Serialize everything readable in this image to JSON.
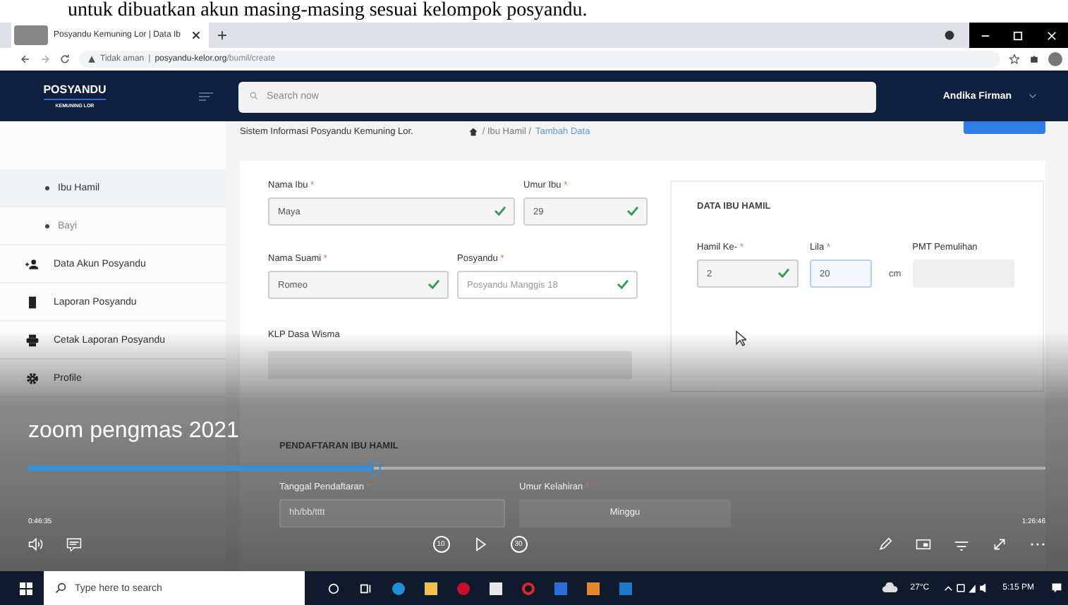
{
  "caption": "untuk dibuatkan akun masing-masing sesuai kelompok posyandu.",
  "browser": {
    "tab_title": "Posyandu Kemuning Lor | Data Ib",
    "new_tab": "+",
    "security": "Tidak aman",
    "separator": "|",
    "url_host": "posyandu-kelor.org",
    "url_path": "/bumil/create"
  },
  "header": {
    "logo": "POSYANDU",
    "logo_sub": "KEMUNING LOR",
    "search_placeholder": "Search now",
    "user": "Andika Firman"
  },
  "sidebar": {
    "items": [
      {
        "label": "Ibu Hamil",
        "kind": "sub",
        "selected": true
      },
      {
        "label": "Bayi",
        "kind": "sub",
        "selected": false
      },
      {
        "label": "Data Akun Posyandu",
        "kind": "users",
        "selected": false
      },
      {
        "label": "Laporan Posyandu",
        "kind": "book",
        "selected": false
      },
      {
        "label": "Cetak Laporan Posyandu",
        "kind": "print",
        "selected": false
      },
      {
        "label": "Profile",
        "kind": "gear",
        "selected": false
      }
    ]
  },
  "breadcrumb": {
    "site": "Sistem Informasi Posyandu Kemuning Lor.",
    "path": "/ Ibu Hamil /",
    "current": "Tambah Data"
  },
  "form": {
    "row1": [
      {
        "label": "Nama Ibu",
        "mark": "*",
        "value": "Maya",
        "valid": true
      },
      {
        "label": "Umur Ibu",
        "mark": "*",
        "value": "29",
        "valid": true
      }
    ],
    "row2": [
      {
        "label": "Nama Suami",
        "mark": "*",
        "value": "Romeo",
        "valid": true
      },
      {
        "label": "Posyandu",
        "mark": "*",
        "placeholder": "Posyandu Manggis 18",
        "valid": true
      }
    ],
    "klp_label": "KLP Dasa Wisma",
    "pregnancy": {
      "title": "DATA IBU HAMIL",
      "fields": [
        {
          "label": "Hamil Ke-",
          "mark": "*",
          "value": "2",
          "valid": true,
          "focused": false,
          "disabled": false
        },
        {
          "label": "Lila",
          "mark": "*",
          "value": "20",
          "unit": "cm",
          "valid": false,
          "focused": true,
          "disabled": false
        },
        {
          "label": "PMT Pemulihan",
          "valid": false,
          "focused": false,
          "disabled": true
        }
      ]
    },
    "registration": {
      "title": "PENDAFTARAN IBU HAMIL",
      "date_label": "Tanggal Pendaftaran",
      "date_mark": "*",
      "date_placeholder": "hh/bb/tttt",
      "age_label": "Umur Kelahiran",
      "age_mark": "*",
      "age_unit": "Minggu"
    }
  },
  "video": {
    "title": "zoom pengmas 2021",
    "elapsed": "0:46:35",
    "total": "1:26:46",
    "progress": {
      "level": 0.34
    },
    "skip_back": "10",
    "skip_fwd": "30"
  },
  "taskbar": {
    "search_placeholder": "Type here to search",
    "temperature": "27°C",
    "time": "5:15 PM"
  }
}
